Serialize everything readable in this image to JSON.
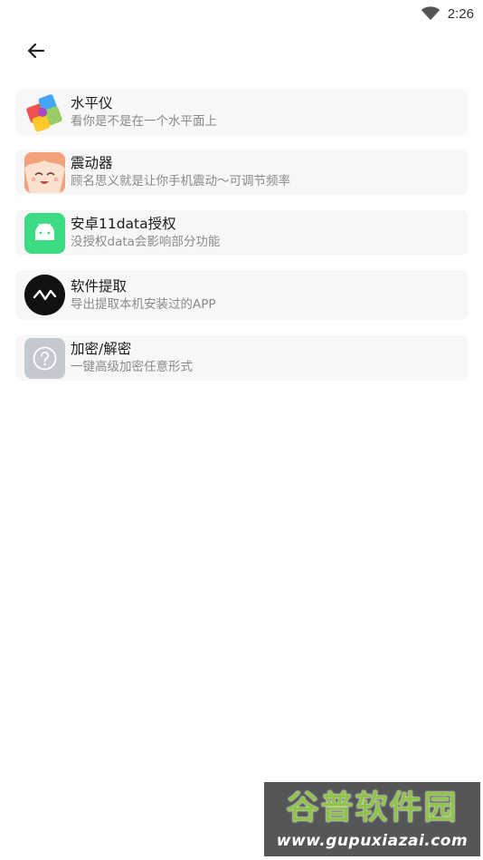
{
  "status_bar": {
    "time": "2:26",
    "wifi_icon": "wifi-icon"
  },
  "toolbar": {
    "back_icon": "arrow-back-icon"
  },
  "items": [
    {
      "title": "水平仪",
      "subtitle": "看你是不是在一个水平面上",
      "icon": "puzzle-colorful-icon"
    },
    {
      "title": "震动器",
      "subtitle": "顾名思义就是让你手机震动～可调节频率",
      "icon": "anime-girl-avatar-icon"
    },
    {
      "title": "安卓11data授权",
      "subtitle": "没授权data会影响部分功能",
      "icon": "android-robot-icon",
      "accent": "#3ddc84"
    },
    {
      "title": "软件提取",
      "subtitle": "导出提取本机安装过的APP",
      "icon": "pulse-circle-icon"
    },
    {
      "title": "加密/解密",
      "subtitle": "一键高级加密任意形式",
      "icon": "question-mark-icon"
    }
  ],
  "watermark": {
    "title": "谷普软件园",
    "url": "www.gupuxiazai.com"
  },
  "colors": {
    "card_bg": "#f7f7f8",
    "android_green": "#3ddc84",
    "watermark_green": "#8fc34a"
  }
}
